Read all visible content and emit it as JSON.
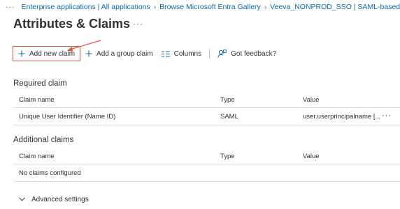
{
  "breadcrumb": {
    "overflow": "···",
    "items": [
      "Enterprise applications | All applications",
      "Browse Microsoft Entra Gallery",
      "Veeva_NONPROD_SSO | SAML-based S"
    ]
  },
  "page": {
    "title": "Attributes & Claims",
    "more": "···"
  },
  "toolbar": {
    "add_new_claim": "Add new claim",
    "add_group_claim": "Add a group claim",
    "columns": "Columns",
    "feedback": "Got feedback?"
  },
  "required": {
    "title": "Required claim",
    "columns": {
      "name": "Claim name",
      "type": "Type",
      "value": "Value"
    },
    "rows": [
      {
        "name": "Unique User Identifier (Name ID)",
        "type": "SAML",
        "value": "user.userprincipalname [...",
        "more": "···"
      }
    ]
  },
  "additional": {
    "title": "Additional claims",
    "columns": {
      "name": "Claim name",
      "type": "Type",
      "value": "Value"
    },
    "empty_text": "No claims configured"
  },
  "advanced": {
    "label": "Advanced settings"
  },
  "colors": {
    "link": "#0a6ab0",
    "highlight": "#e0533a",
    "text": "#323130"
  }
}
